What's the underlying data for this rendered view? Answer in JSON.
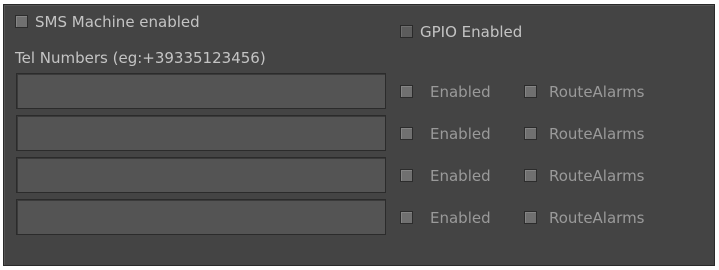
{
  "sms": {
    "enabled_label": "SMS Machine enabled",
    "enabled_checked": false,
    "tel_numbers_label": "Tel Numbers (eg:+39335123456)"
  },
  "gpio": {
    "enabled_label": "GPIO Enabled",
    "enabled_checked": false
  },
  "rows": [
    {
      "number": "",
      "enabled_label": "Enabled",
      "enabled_checked": false,
      "route_alarms_label": "RouteAlarms",
      "route_alarms_checked": false
    },
    {
      "number": "",
      "enabled_label": "Enabled",
      "enabled_checked": false,
      "route_alarms_label": "RouteAlarms",
      "route_alarms_checked": false
    },
    {
      "number": "",
      "enabled_label": "Enabled",
      "enabled_checked": false,
      "route_alarms_label": "RouteAlarms",
      "route_alarms_checked": false
    },
    {
      "number": "",
      "enabled_label": "Enabled",
      "enabled_checked": false,
      "route_alarms_label": "RouteAlarms",
      "route_alarms_checked": false
    }
  ],
  "colors": {
    "panel_background": "#444444",
    "field_background": "#545454",
    "label_text": "#c4c4c4",
    "label_text_dim": "#9a9a9a"
  }
}
